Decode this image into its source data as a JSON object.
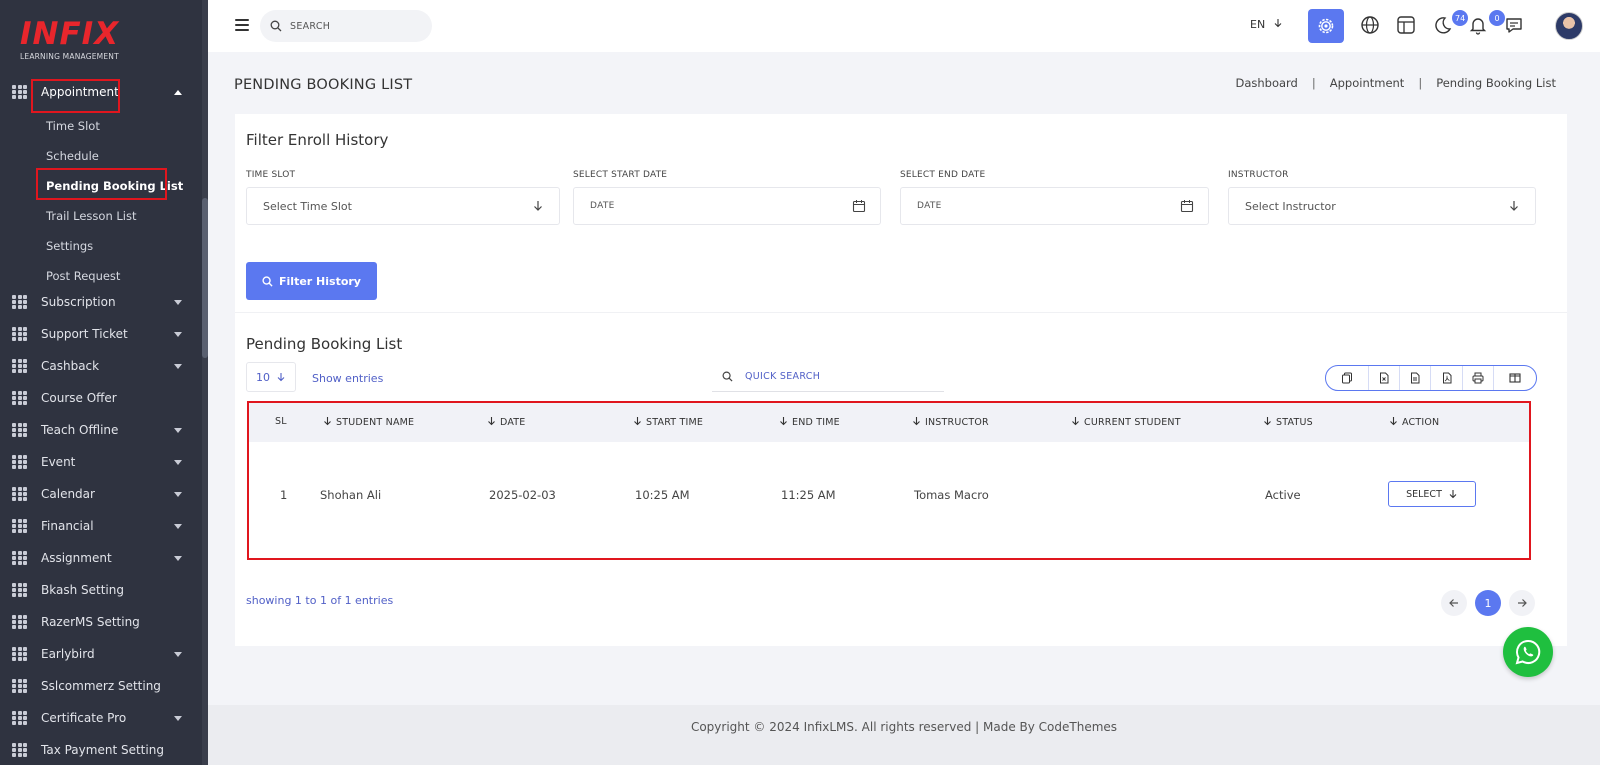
{
  "brand": {
    "logo": "INFIX",
    "subtitle": "LEARNING MANAGEMENT"
  },
  "sidebar": {
    "active_group": "Appointment",
    "sub_items": [
      "Time Slot",
      "Schedule",
      "Pending Booking List",
      "Trail Lesson List",
      "Settings",
      "Post Request"
    ],
    "active_sub_item": "Pending Booking List",
    "items": [
      {
        "label": "Subscription",
        "caret": true
      },
      {
        "label": "Support Ticket",
        "caret": true
      },
      {
        "label": "Cashback",
        "caret": true
      },
      {
        "label": "Course Offer",
        "caret": false
      },
      {
        "label": "Teach Offline",
        "caret": true
      },
      {
        "label": "Event",
        "caret": true
      },
      {
        "label": "Calendar",
        "caret": true
      },
      {
        "label": "Financial",
        "caret": true
      },
      {
        "label": "Assignment",
        "caret": true
      },
      {
        "label": "Bkash Setting",
        "caret": false
      },
      {
        "label": "RazerMS Setting",
        "caret": false
      },
      {
        "label": "Earlybird",
        "caret": true
      },
      {
        "label": "Sslcommerz Setting",
        "caret": false
      },
      {
        "label": "Certificate Pro",
        "caret": true
      },
      {
        "label": "Tax Payment Setting",
        "caret": false
      }
    ]
  },
  "header": {
    "search_placeholder": "SEARCH",
    "language": "EN",
    "notification_count": "74",
    "message_count": "0"
  },
  "page": {
    "title": "PENDING BOOKING LIST",
    "breadcrumb": [
      "Dashboard",
      "Appointment",
      "Pending Booking List"
    ]
  },
  "filter": {
    "title": "Filter Enroll History",
    "fields": [
      {
        "label": "TIME SLOT",
        "placeholder": "Select Time Slot",
        "type": "select"
      },
      {
        "label": "SELECT START DATE",
        "placeholder": "DATE",
        "type": "date"
      },
      {
        "label": "SELECT END DATE",
        "placeholder": "DATE",
        "type": "date"
      },
      {
        "label": "INSTRUCTOR",
        "placeholder": "Select Instructor",
        "type": "select"
      }
    ],
    "button_label": "Filter History"
  },
  "list": {
    "title": "Pending Booking List",
    "entries_value": "10",
    "show_entries_label": "Show entries",
    "quick_search_placeholder": "QUICK SEARCH",
    "export_buttons": [
      "copy-icon",
      "excel-icon",
      "csv-icon",
      "pdf-icon",
      "print-icon",
      "columns-icon"
    ],
    "columns": [
      "SL",
      "STUDENT NAME",
      "DATE",
      "START TIME",
      "END TIME",
      "INSTRUCTOR",
      "CURRENT STUDENT",
      "STATUS",
      "ACTION"
    ],
    "rows": [
      {
        "sl": "1",
        "student": "Shohan Ali",
        "date": "2025-02-03",
        "start": "10:25 AM",
        "end": "11:25 AM",
        "instructor": "Tomas Macro",
        "current_student": "",
        "status": "Active",
        "action": "SELECT"
      }
    ],
    "showing_text": "showing 1 to 1 of 1 entries",
    "current_page": "1"
  },
  "footer": {
    "text": "Copyright © 2024 InfixLMS. All rights reserved | Made By CodeThemes"
  },
  "colors": {
    "accent": "#5b78f0",
    "sidebar_bg": "#2f3340",
    "highlight": "#e0161e",
    "whatsapp": "#1fbf3f"
  }
}
